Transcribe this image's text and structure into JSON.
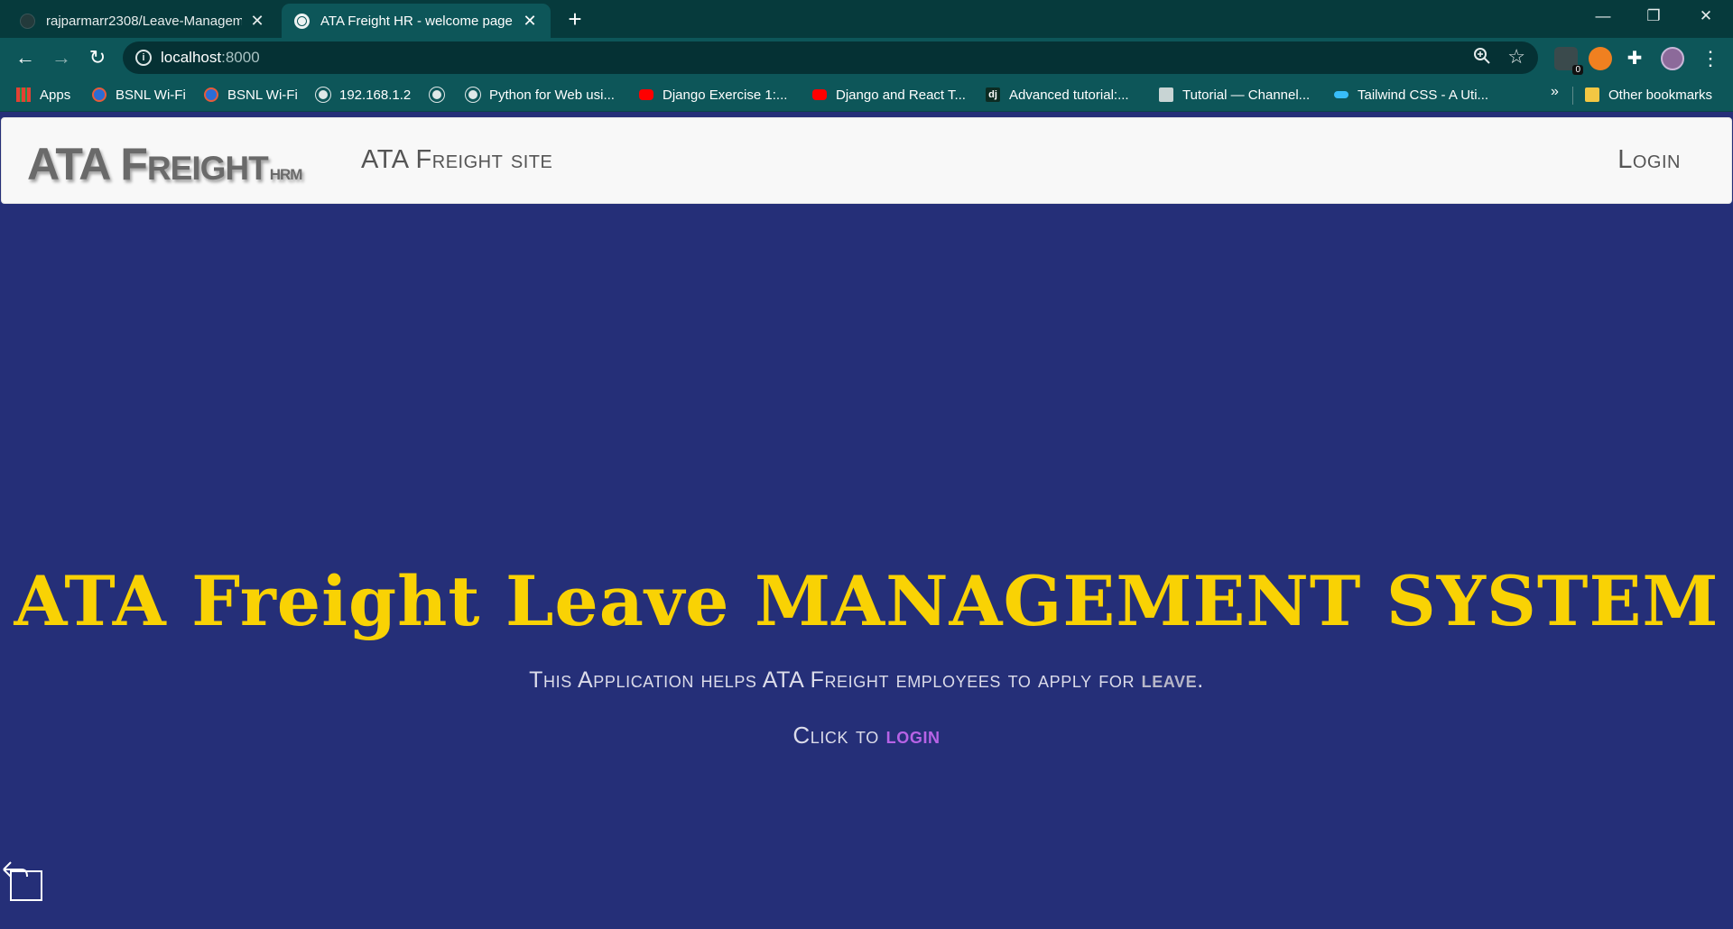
{
  "browser": {
    "tabs": [
      {
        "title": "rajparmarr2308/Leave-Managem",
        "close": "✕"
      },
      {
        "title": "ATA Freight HR - welcome page",
        "close": "✕"
      }
    ],
    "new_tab": "+",
    "window_controls": {
      "minimize": "—",
      "restore": "❐",
      "close": "✕"
    },
    "nav": {
      "back": "←",
      "forward": "→",
      "reload": "↻"
    },
    "url": {
      "host": "localhost",
      "port": ":8000"
    },
    "zoom_icon": "magnifier-icon",
    "bookmark_star": "☆",
    "extensions": {
      "badge_count": "0",
      "puzzle": "✚",
      "menu": "⋮"
    },
    "bookmarks": [
      {
        "label": "Apps",
        "icon": "grid"
      },
      {
        "label": "BSNL Wi-Fi",
        "icon": "wifi"
      },
      {
        "label": "BSNL Wi-Fi",
        "icon": "wifi"
      },
      {
        "label": "192.168.1.2",
        "icon": "globe"
      },
      {
        "label": "",
        "icon": "globe"
      },
      {
        "label": "Python for Web usi...",
        "icon": "globe"
      },
      {
        "label": "Django Exercise 1:...",
        "icon": "yt"
      },
      {
        "label": "Django and React T...",
        "icon": "yt"
      },
      {
        "label": "Advanced tutorial:...",
        "icon": "dj"
      },
      {
        "label": "Tutorial — Channel...",
        "icon": "doc"
      },
      {
        "label": "Tailwind CSS - A Uti...",
        "icon": "tw"
      }
    ],
    "bookmarks_more": "»",
    "other_bookmarks": "Other bookmarks"
  },
  "page": {
    "logo": {
      "part1": "ATA F",
      "part2": "REIGHT",
      "part3": "HRM"
    },
    "site_link": "ATA Freight site",
    "login_link": "Login",
    "hero_title": "ATA Freight Leave MANAGEMENT SYSTEM",
    "hero_subtitle_prefix": "This Application helps ATA Freight employees to apply for ",
    "hero_subtitle_emphasis": "leave",
    "hero_subtitle_suffix": ".",
    "cta_prefix": "Click to ",
    "cta_link": "login"
  },
  "colors": {
    "page_background": "#252f78",
    "title": "#f9d204",
    "cta_link": "#b763e6",
    "chrome": "#0d5659"
  }
}
